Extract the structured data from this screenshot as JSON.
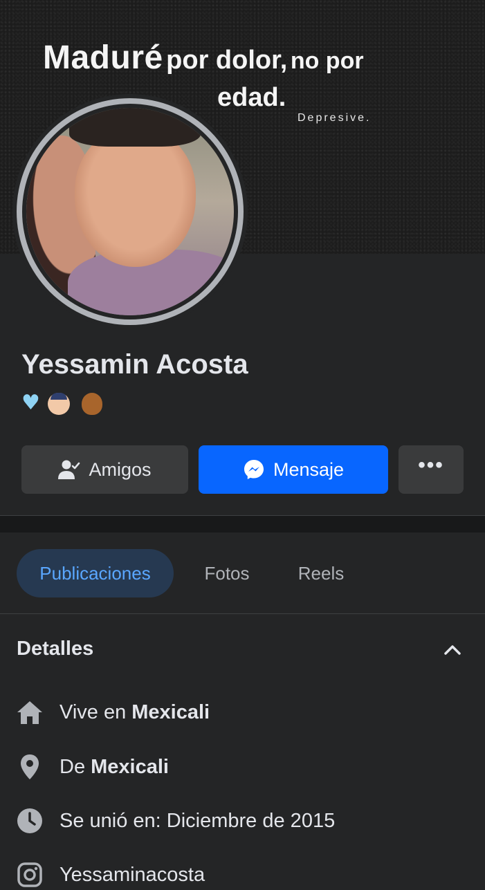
{
  "cover": {
    "quote_part1": "Maduré",
    "quote_part2": "por dolor,",
    "quote_part3": "no por",
    "quote_line2": "edad.",
    "signature": "Depresive."
  },
  "profile": {
    "name": "Yessamin Acosta",
    "emojis": [
      "blue-heart",
      "old-man-face",
      "teddy-bear"
    ]
  },
  "actions": {
    "friends_label": "Amigos",
    "message_label": "Mensaje",
    "more_label": "•••"
  },
  "tabs": [
    {
      "label": "Publicaciones",
      "active": true
    },
    {
      "label": "Fotos",
      "active": false
    },
    {
      "label": "Reels",
      "active": false
    }
  ],
  "details": {
    "title": "Detalles",
    "items": [
      {
        "icon": "home-icon",
        "prefix": "Vive en ",
        "bold": "Mexicali"
      },
      {
        "icon": "location-pin-icon",
        "prefix": "De ",
        "bold": "Mexicali"
      },
      {
        "icon": "clock-icon",
        "prefix": "Se unió en: Diciembre de 2015",
        "bold": ""
      },
      {
        "icon": "instagram-icon",
        "prefix": "Yessaminacosta",
        "bold": ""
      }
    ]
  },
  "colors": {
    "background": "#242526",
    "accent_blue": "#0866ff",
    "active_tab_bg": "#263951",
    "active_tab_text": "#5aa7ff",
    "button_gray": "#3a3b3c"
  }
}
